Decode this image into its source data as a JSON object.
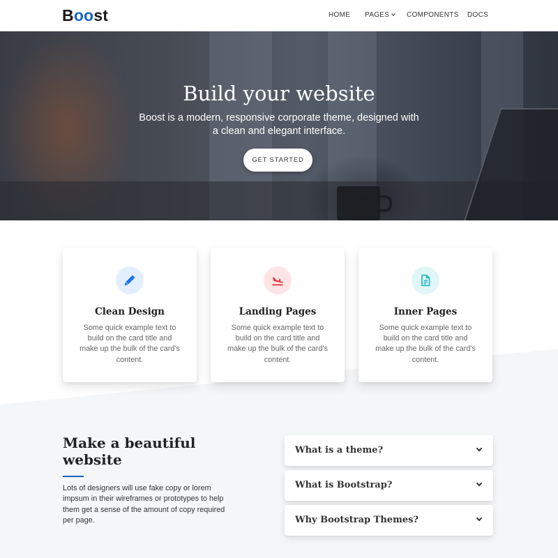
{
  "brand": {
    "prefix": "B",
    "accent": "oo",
    "suffix": "st",
    "accent_color": "#1565c0"
  },
  "nav": {
    "home": "HOME",
    "pages": "PAGES",
    "components": "COMPONENTS",
    "docs": "DOCS"
  },
  "hero": {
    "title": "Build your website",
    "subtitle": "Boost is a modern, responsive corporate theme, designed with a clean and elegant interface.",
    "cta": "GET STARTED"
  },
  "features": [
    {
      "icon": "pen-icon",
      "title": "Clean Design",
      "text": "Some quick example text to build on the card title and make up the bulk of the card's content.",
      "icon_color": "#1e73e8"
    },
    {
      "icon": "plane-landing-icon",
      "title": "Landing Pages",
      "text": "Some quick example text to build on the card title and make up the bulk of the card's content.",
      "icon_color": "#e8323c"
    },
    {
      "icon": "document-icon",
      "title": "Inner Pages",
      "text": "Some quick example text to build on the card title and make up the bulk of the card's content.",
      "icon_color": "#19b5bd"
    }
  ],
  "about": {
    "title": "Make a beautiful website",
    "text": "Lots of designers will use fake copy or lorem impsum in their wireframes or prototypes to help them get a sense of the amount of copy required per page."
  },
  "faq": [
    {
      "question": "What is a theme?"
    },
    {
      "question": "What is Bootstrap?"
    },
    {
      "question": "Why Bootstrap Themes?"
    }
  ]
}
